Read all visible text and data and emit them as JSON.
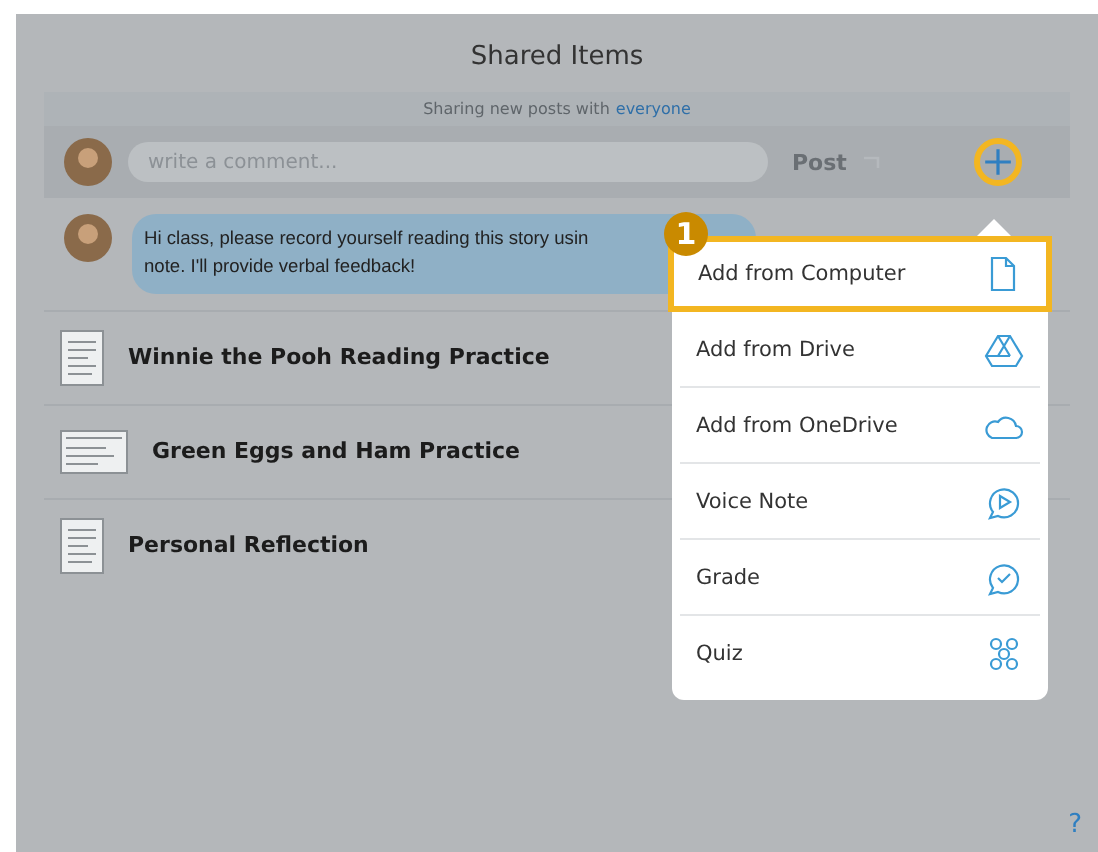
{
  "title": "Shared Items",
  "sharing": {
    "text": "Sharing new posts with",
    "audience": "everyone"
  },
  "composer": {
    "placeholder": "write a comment...",
    "post": "Post"
  },
  "message": {
    "lines": [
      "Hi class, please record yourself reading this story usin",
      "note. I'll provide verbal feedback!"
    ]
  },
  "items": [
    {
      "title": "Winnie the Pooh Reading Practice",
      "kind": "portrait"
    },
    {
      "title": "Green Eggs and Ham Practice",
      "kind": "landscape"
    },
    {
      "title": "Personal Reflection",
      "kind": "portrait"
    }
  ],
  "menu": {
    "badge": "1",
    "items": [
      {
        "label": "Add from Computer",
        "kind": "file",
        "selected": true
      },
      {
        "label": "Add from Drive",
        "kind": "drive",
        "selected": false
      },
      {
        "label": "Add from OneDrive",
        "kind": "cloud",
        "selected": false
      },
      {
        "label": "Voice Note",
        "kind": "play",
        "selected": false
      },
      {
        "label": "Grade",
        "kind": "check",
        "selected": false
      },
      {
        "label": "Quiz",
        "kind": "dots",
        "selected": false
      }
    ]
  },
  "help": "?"
}
